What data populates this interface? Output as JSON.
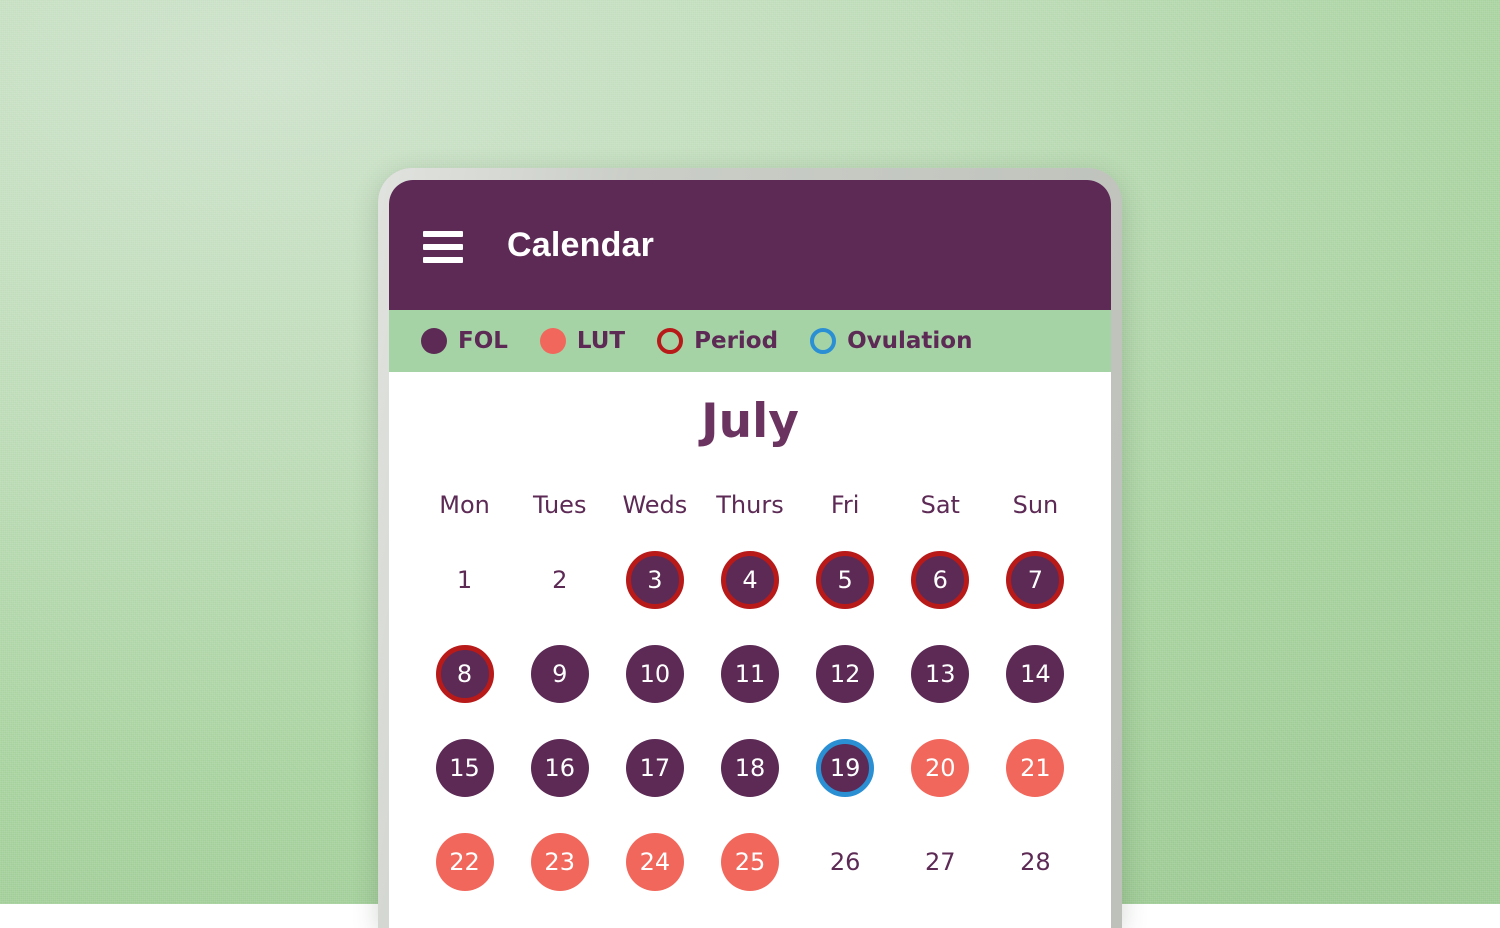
{
  "background": {
    "color_from": "#cfe3cc",
    "color_to": "#9ecb95"
  },
  "device": {
    "bezel_color": "#c7cbc4"
  },
  "appbar": {
    "title": "Calendar",
    "menu_icon": "hamburger-menu-icon",
    "background_color": "#5c2a55",
    "text_color": "#ffffff"
  },
  "legend": {
    "background_color": "#a5d3a5",
    "items": [
      {
        "label": "FOL",
        "style": "filled",
        "color": "#5c2a55",
        "icon": "filled-circle-icon"
      },
      {
        "label": "LUT",
        "style": "filled",
        "color": "#f2675c",
        "icon": "filled-circle-icon"
      },
      {
        "label": "Period",
        "style": "ring",
        "color": "#b81a1a",
        "icon": "ring-circle-icon"
      },
      {
        "label": "Ovulation",
        "style": "ring",
        "color": "#2b8fd4",
        "icon": "ring-circle-icon"
      }
    ]
  },
  "calendar": {
    "month": "July",
    "month_color": "#6b3360",
    "weekdays": [
      "Mon",
      "Tues",
      "Weds",
      "Thurs",
      "Fri",
      "Sat",
      "Sun"
    ],
    "weeks": [
      [
        {
          "day": "1",
          "fill": "none",
          "ring": "none"
        },
        {
          "day": "2",
          "fill": "none",
          "ring": "none"
        },
        {
          "day": "3",
          "fill": "fol",
          "ring": "period"
        },
        {
          "day": "4",
          "fill": "fol",
          "ring": "period"
        },
        {
          "day": "5",
          "fill": "fol",
          "ring": "period"
        },
        {
          "day": "6",
          "fill": "fol",
          "ring": "period"
        },
        {
          "day": "7",
          "fill": "fol",
          "ring": "period"
        }
      ],
      [
        {
          "day": "8",
          "fill": "fol",
          "ring": "period"
        },
        {
          "day": "9",
          "fill": "fol",
          "ring": "none"
        },
        {
          "day": "10",
          "fill": "fol",
          "ring": "none"
        },
        {
          "day": "11",
          "fill": "fol",
          "ring": "none"
        },
        {
          "day": "12",
          "fill": "fol",
          "ring": "none"
        },
        {
          "day": "13",
          "fill": "fol",
          "ring": "none"
        },
        {
          "day": "14",
          "fill": "fol",
          "ring": "none"
        }
      ],
      [
        {
          "day": "15",
          "fill": "fol",
          "ring": "none"
        },
        {
          "day": "16",
          "fill": "fol",
          "ring": "none"
        },
        {
          "day": "17",
          "fill": "fol",
          "ring": "none"
        },
        {
          "day": "18",
          "fill": "fol",
          "ring": "none"
        },
        {
          "day": "19",
          "fill": "fol",
          "ring": "ovulation"
        },
        {
          "day": "20",
          "fill": "lut",
          "ring": "none"
        },
        {
          "day": "21",
          "fill": "lut",
          "ring": "none"
        }
      ],
      [
        {
          "day": "22",
          "fill": "lut",
          "ring": "none"
        },
        {
          "day": "23",
          "fill": "lut",
          "ring": "none"
        },
        {
          "day": "24",
          "fill": "lut",
          "ring": "none"
        },
        {
          "day": "25",
          "fill": "lut",
          "ring": "none"
        },
        {
          "day": "26",
          "fill": "none",
          "ring": "none"
        },
        {
          "day": "27",
          "fill": "none",
          "ring": "none"
        },
        {
          "day": "28",
          "fill": "none",
          "ring": "none"
        }
      ]
    ]
  }
}
